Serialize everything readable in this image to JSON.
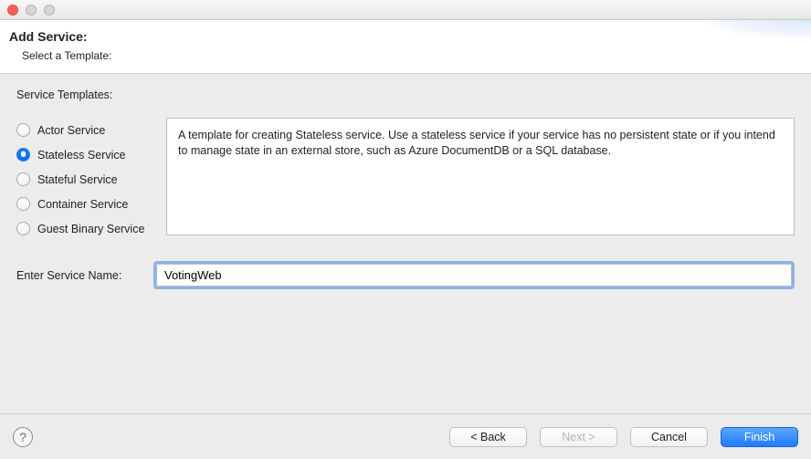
{
  "header": {
    "title": "Add Service:",
    "subtitle": "Select a Template:"
  },
  "templates": {
    "section_label": "Service Templates:",
    "selected_index": 1,
    "items": [
      {
        "label": "Actor Service"
      },
      {
        "label": "Stateless Service"
      },
      {
        "label": "Stateful Service"
      },
      {
        "label": "Container Service"
      },
      {
        "label": "Guest Binary Service"
      }
    ],
    "description": "A template for creating Stateless service.  Use a stateless service if your service has no persistent state or if you intend to manage state in an external store, such as Azure DocumentDB or a SQL database."
  },
  "service_name": {
    "label": "Enter Service Name:",
    "value": "VotingWeb"
  },
  "footer": {
    "help_tooltip": "Help",
    "back": "< Back",
    "next": "Next >",
    "cancel": "Cancel",
    "finish": "Finish",
    "next_enabled": false
  }
}
